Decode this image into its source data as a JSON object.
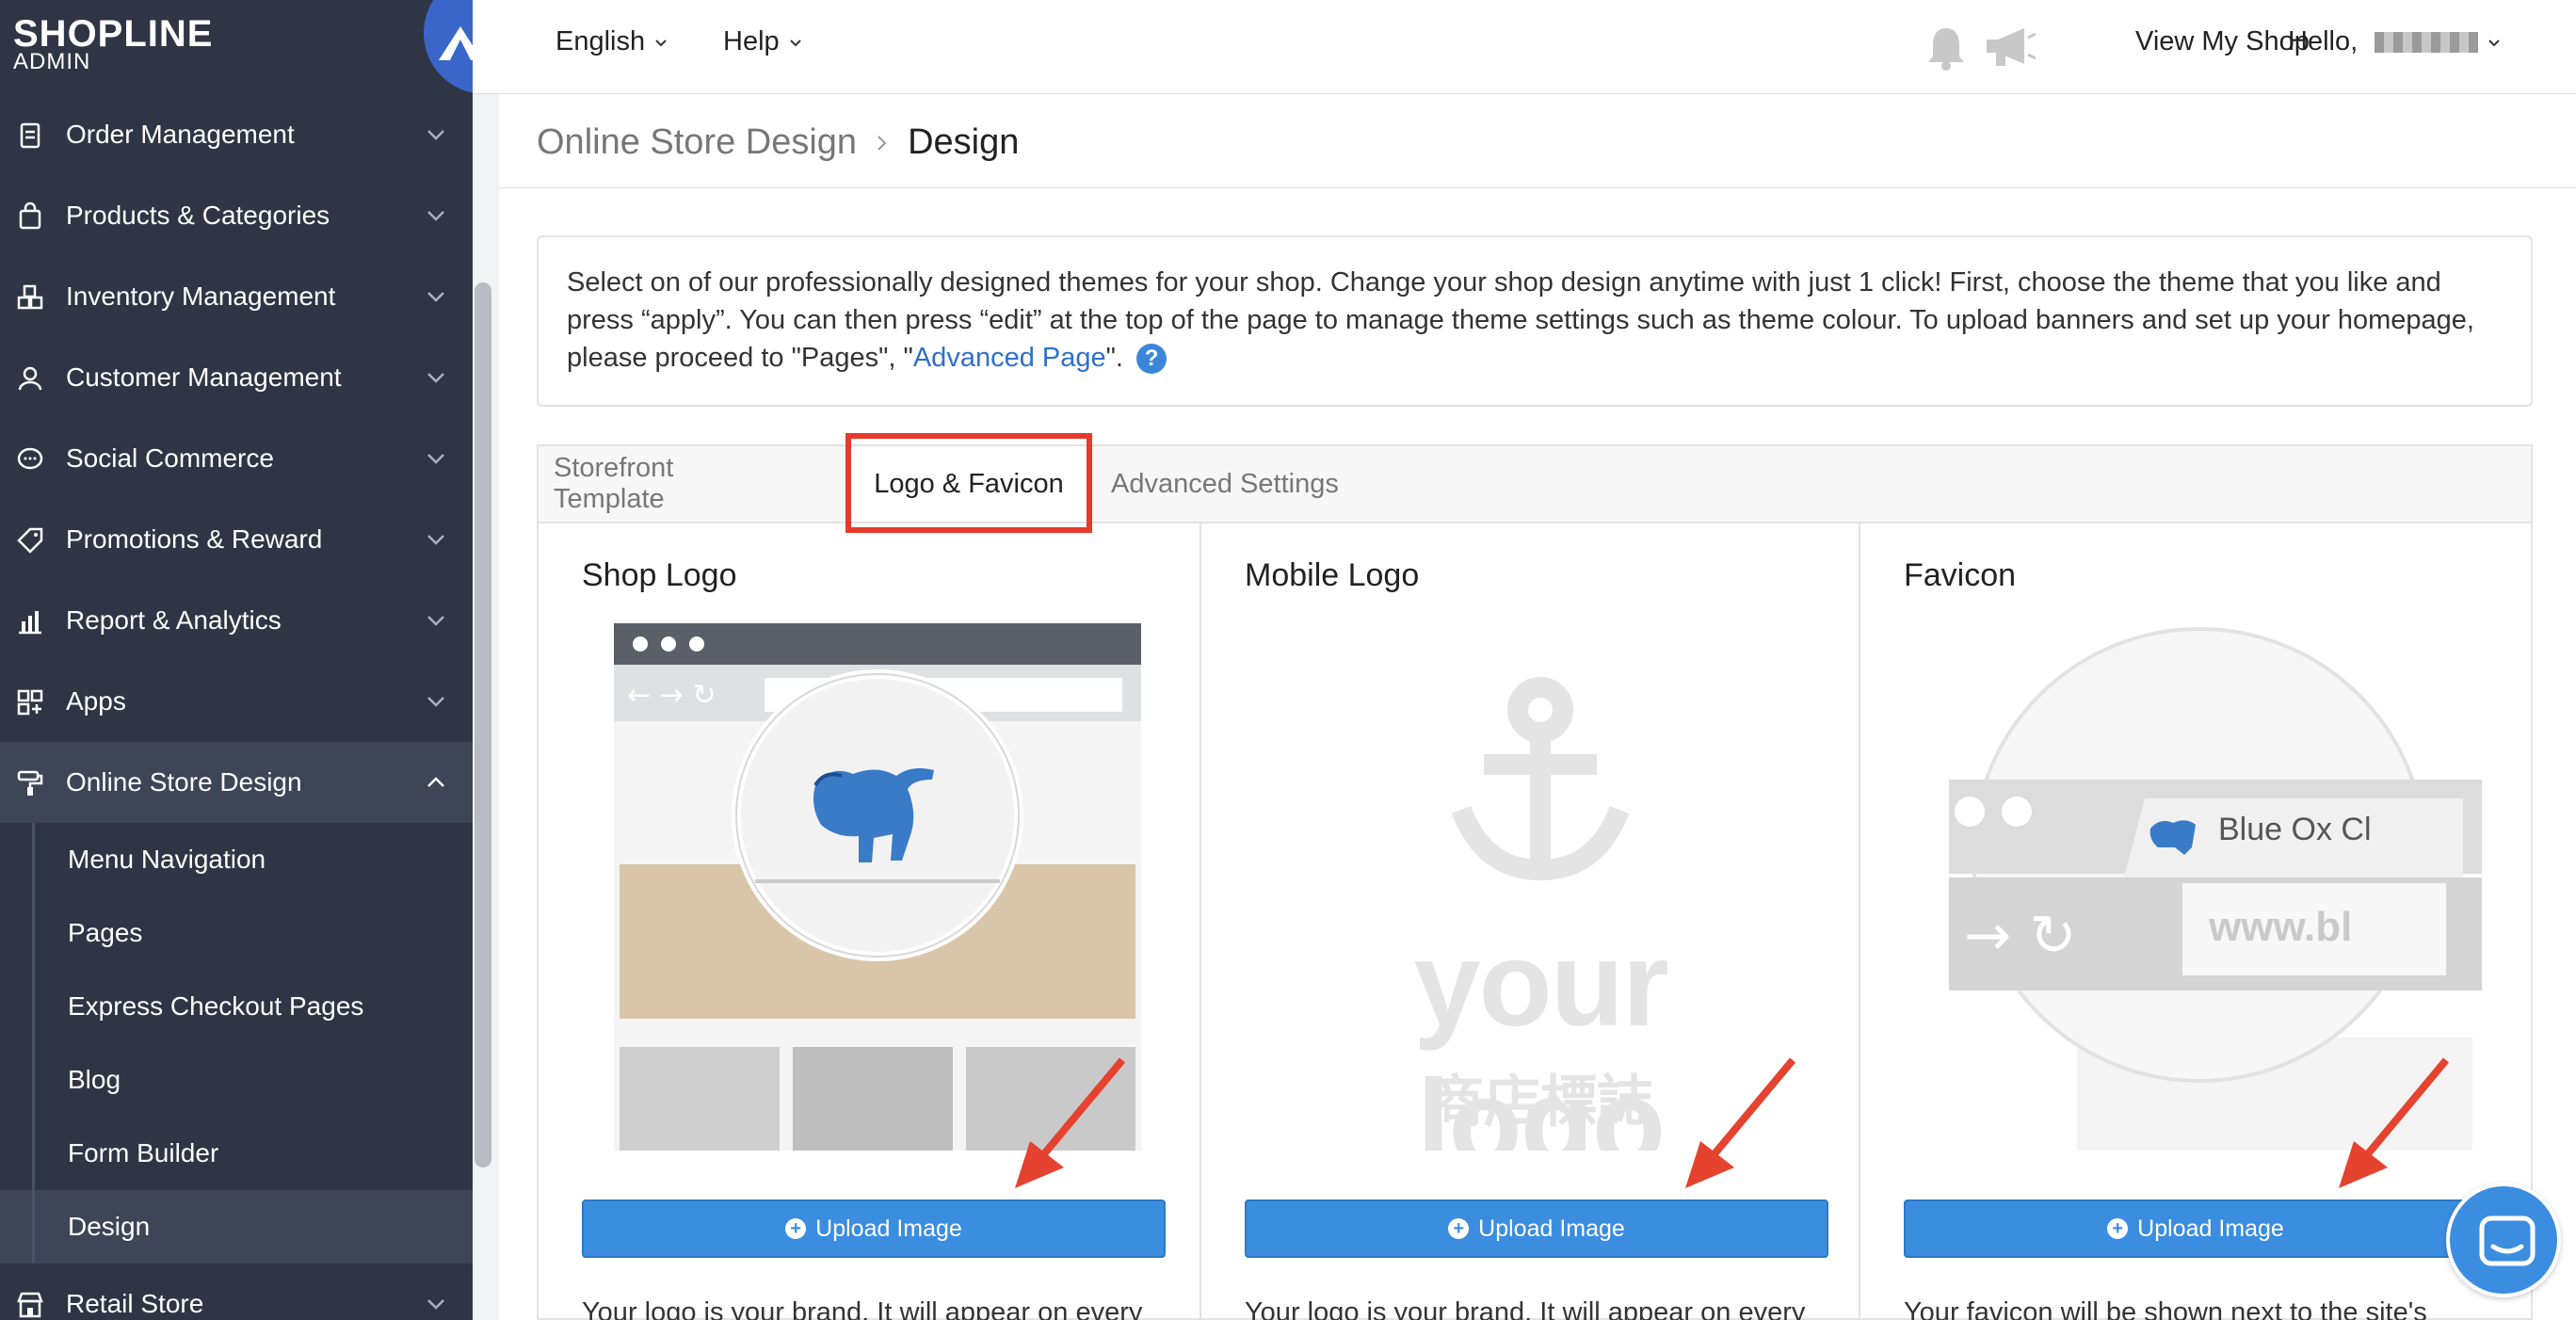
{
  "brand": {
    "name": "SHOPLINE",
    "sub": "ADMIN"
  },
  "sidebar": {
    "items": [
      {
        "label": "Order Management",
        "icon": "clipboard-icon"
      },
      {
        "label": "Products & Categories",
        "icon": "shopping-bag-icon"
      },
      {
        "label": "Inventory Management",
        "icon": "boxes-icon"
      },
      {
        "label": "Customer Management",
        "icon": "user-icon"
      },
      {
        "label": "Social Commerce",
        "icon": "chat-bubble-icon"
      },
      {
        "label": "Promotions & Reward",
        "icon": "tag-icon"
      },
      {
        "label": "Report & Analytics",
        "icon": "bar-chart-icon"
      },
      {
        "label": "Apps",
        "icon": "apps-grid-icon"
      },
      {
        "label": "Online Store Design",
        "icon": "paint-roller-icon"
      }
    ],
    "sub_items": [
      {
        "label": "Menu Navigation"
      },
      {
        "label": "Pages"
      },
      {
        "label": "Express Checkout Pages"
      },
      {
        "label": "Blog"
      },
      {
        "label": "Form Builder"
      },
      {
        "label": "Design"
      }
    ],
    "after_items": [
      {
        "label": "Retail Store",
        "icon": "store-icon"
      }
    ]
  },
  "topbar": {
    "language": "English",
    "help": "Help",
    "view_shop": "View My Shop",
    "greeting": "Hello,"
  },
  "breadcrumb": {
    "parent": "Online Store Design",
    "current": "Design"
  },
  "intro": {
    "text_before": "Select on of our professionally designed themes for your shop. Change your shop design anytime with just 1 click! First, choose the theme that you like and press “apply”. You can then press “edit” at the top of the page to manage theme settings such as theme colour. To upload banners and set up your homepage, please proceed to \"Pages\", \"",
    "link": "Advanced Page",
    "text_after": "\".",
    "help_glyph": "?"
  },
  "tabs": [
    {
      "label": "Storefront Template"
    },
    {
      "label": "Logo & Favicon"
    },
    {
      "label": "Advanced Settings"
    }
  ],
  "columns": [
    {
      "title": "Shop Logo",
      "button": "Upload Image",
      "desc": "Your logo is your brand. It will appear on every"
    },
    {
      "title": "Mobile Logo",
      "button": "Upload Image",
      "desc": "Your logo is your brand. It will appear on every"
    },
    {
      "title": "Favicon",
      "button": "Upload Image",
      "desc": "Your favicon will be shown next to the site's"
    }
  ],
  "images": {
    "mobile_placeholder_text": "your logo",
    "mobile_placeholder_cjk": "商店標誌",
    "favicon_tab_text": "Blue Ox Cl",
    "favicon_url_text": "www.bl"
  },
  "colors": {
    "sidebar": "#2f3544",
    "accent": "#3b8de0",
    "highlight": "#e53a2c"
  }
}
